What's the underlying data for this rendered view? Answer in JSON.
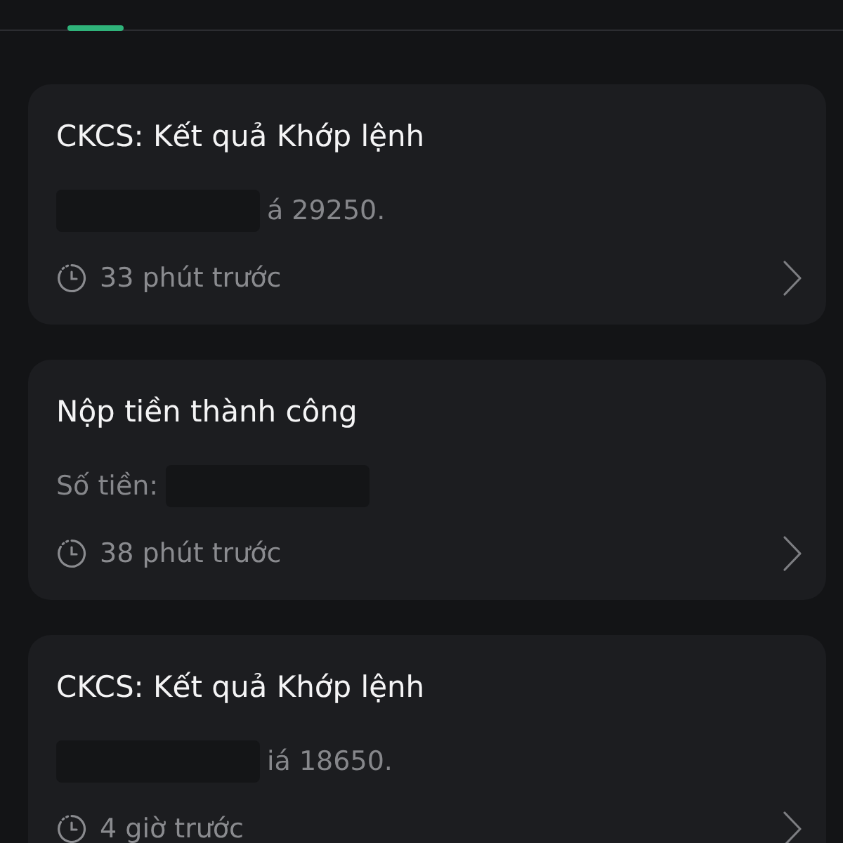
{
  "tabs": [
    {
      "selected": true
    }
  ],
  "notifications": [
    {
      "title": "CKCS: Kết quả Khớp lệnh",
      "masked_start": true,
      "body": "á 29250.",
      "masked_end": false,
      "time": "33 phút trước"
    },
    {
      "title": "Nộp tiền thành công",
      "masked_start": false,
      "body": "Số tiền:",
      "masked_end": true,
      "time": "38 phút trước"
    },
    {
      "title": "CKCS: Kết quả Khớp lệnh",
      "masked_start": true,
      "body": "iá 18650.",
      "masked_end": false,
      "time": "4 giờ trước"
    }
  ]
}
